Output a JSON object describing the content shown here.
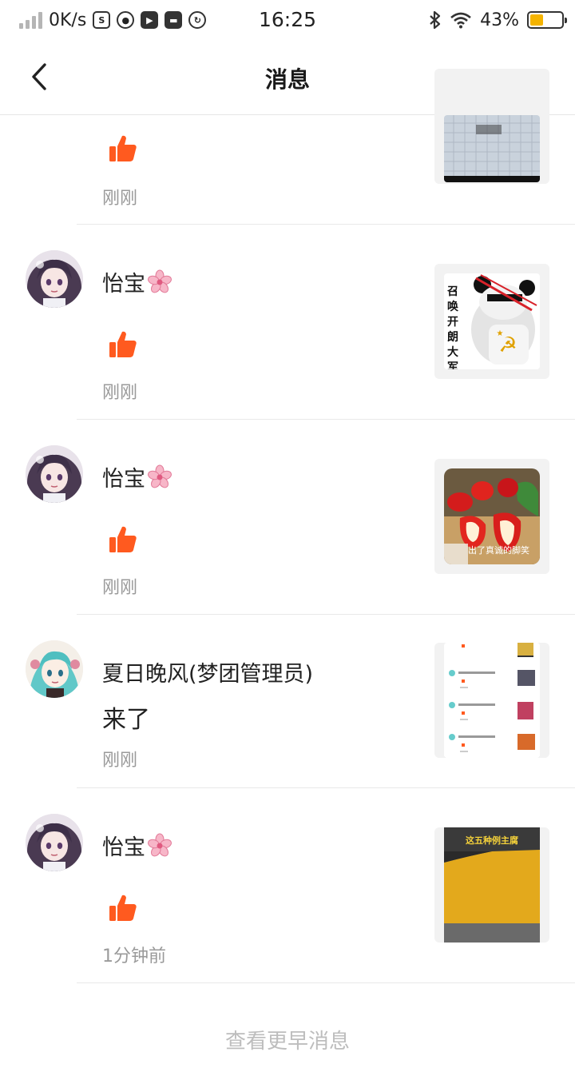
{
  "status_bar": {
    "speed": "0K/s",
    "time": "16:25",
    "battery_percent": "43%",
    "battery_level": 0.43
  },
  "nav": {
    "title": "消息",
    "back_icon": "chevron-left-icon"
  },
  "messages": [
    {
      "name": "",
      "content_type": "like",
      "time": "刚刚"
    },
    {
      "name": "怡宝",
      "content_type": "like",
      "time": "刚刚",
      "thumb_text": "召唤开朗大军"
    },
    {
      "name": "怡宝",
      "content_type": "like",
      "time": "刚刚",
      "thumb_caption": "出了真诚的脚笑"
    },
    {
      "name": "夏日晚风(梦团管理员)",
      "content_type": "comment",
      "comment": "来了",
      "time": "刚刚"
    },
    {
      "name": "怡宝",
      "content_type": "like",
      "time": "1分钟前",
      "thumb_caption": "这五种例主腐"
    }
  ],
  "footer": {
    "more_label": "查看更早消息"
  },
  "colors": {
    "like": "#ff5a1f",
    "time_gray": "#9a9a9a",
    "more_gray": "#bdbdbd"
  }
}
